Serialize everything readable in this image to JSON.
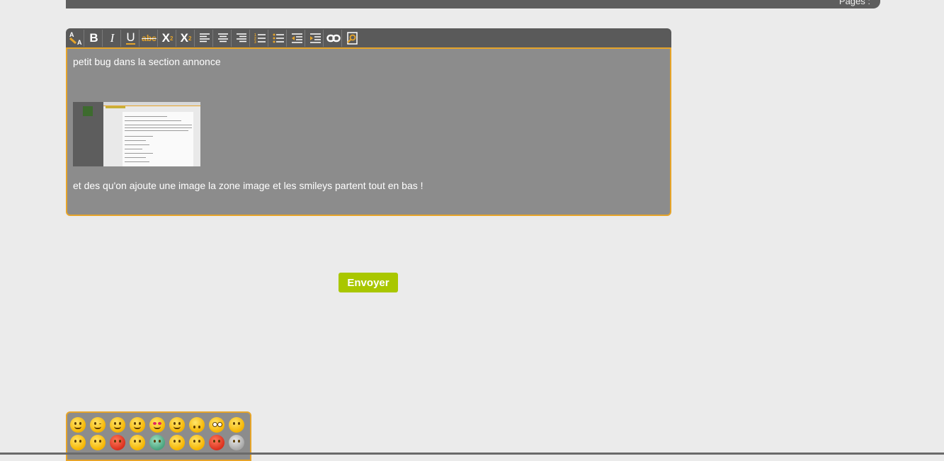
{
  "header": {
    "pages_label": "Pages :"
  },
  "toolbar": {
    "buttons": [
      {
        "name": "font-color-icon",
        "label": ""
      },
      {
        "name": "bold-button",
        "label": "B"
      },
      {
        "name": "italic-button",
        "label": "I"
      },
      {
        "name": "underline-button",
        "label": "U"
      },
      {
        "name": "strikethrough-button",
        "label": "abc"
      },
      {
        "name": "subscript-button",
        "label": "X"
      },
      {
        "name": "superscript-button",
        "label": "X"
      },
      {
        "name": "align-left-icon",
        "label": ""
      },
      {
        "name": "align-center-icon",
        "label": ""
      },
      {
        "name": "align-right-icon",
        "label": ""
      },
      {
        "name": "ordered-list-icon",
        "label": ""
      },
      {
        "name": "unordered-list-icon",
        "label": ""
      },
      {
        "name": "outdent-icon",
        "label": ""
      },
      {
        "name": "indent-icon",
        "label": ""
      },
      {
        "name": "link-icon",
        "label": ""
      },
      {
        "name": "preview-icon",
        "label": ""
      }
    ],
    "bold_label": "B",
    "italic_label": "I",
    "underline_label": "U",
    "strike_label": "abc",
    "sub_label": "X",
    "sup_label": "X",
    "sub_index": "2",
    "sup_index": "2"
  },
  "editor": {
    "line1": "petit bug dans la section annonce",
    "line2": "et des qu'on ajoute une image la zone image et les smileys partent tout en bas !"
  },
  "form": {
    "submit_label": "Envoyer"
  },
  "colors": {
    "accent": "#e6a429",
    "submit": "#a9c700",
    "toolbar": "#5a5a5a",
    "editor_bg": "#8c8c8c"
  }
}
